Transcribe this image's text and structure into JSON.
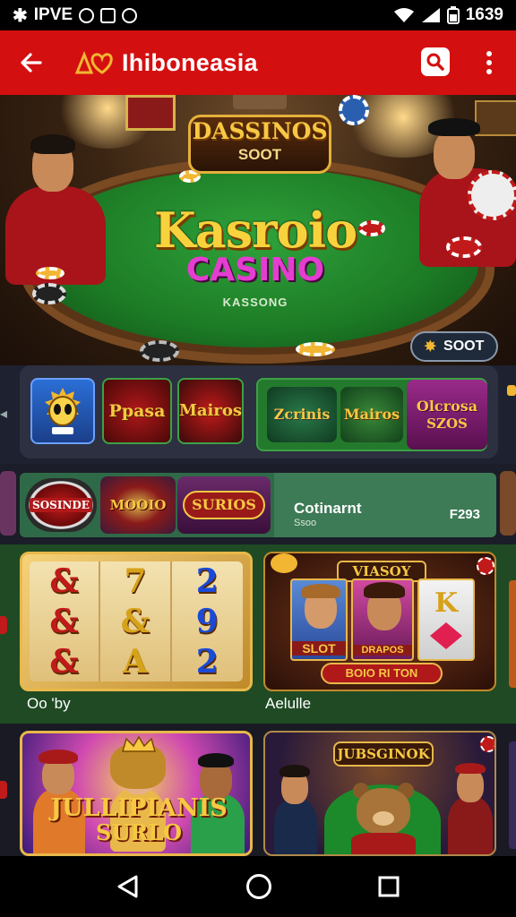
{
  "status_bar": {
    "carrier": "IPVE",
    "time": "1639"
  },
  "app_bar": {
    "title": "Ihiboneasia"
  },
  "hero": {
    "sign_title": "DASSINOS",
    "sign_subtitle": "SOOT",
    "title": "Kasroio",
    "subtitle": "CASINO",
    "caption": "KASSONG",
    "pill_label": "SOOT"
  },
  "row1": {
    "tiles": [
      {
        "label": ""
      },
      {
        "label": "Ppasa"
      },
      {
        "label": "Mairos"
      }
    ],
    "green_tiles": [
      {
        "label": "Zcrinis"
      },
      {
        "label": "Mairos"
      },
      {
        "label": "Olcrosa",
        "sub": "SZOS"
      }
    ]
  },
  "row2": {
    "tiles": [
      {
        "label": "SOSINDE"
      },
      {
        "label": "MOOIO"
      },
      {
        "label": "SURIOS"
      }
    ],
    "panel_title": "Cotinarnt",
    "panel_subtitle": "Ssoo",
    "panel_count": "F293"
  },
  "row3": {
    "slot_symbols": [
      "&",
      "7",
      "2",
      "&",
      "&",
      "9",
      "&",
      "A",
      "2"
    ],
    "card1_caption": "Oo 'by",
    "card2_sign": "VIASOY",
    "card2_banner": "BOIO RI TON",
    "card2_reels": [
      "SLOT",
      "DRAPOS",
      "K"
    ],
    "card2_caption": "Aelulle"
  },
  "row4": {
    "card1_title": "JULLIPIANIS",
    "card1_subtitle": "SURLO",
    "card2_sign": "JUBSGINOK"
  },
  "colors": {
    "app_bar": "#d40f10",
    "felt": "#1c7a25",
    "gold": "#f8d23c",
    "magenta": "#e43dd0"
  }
}
